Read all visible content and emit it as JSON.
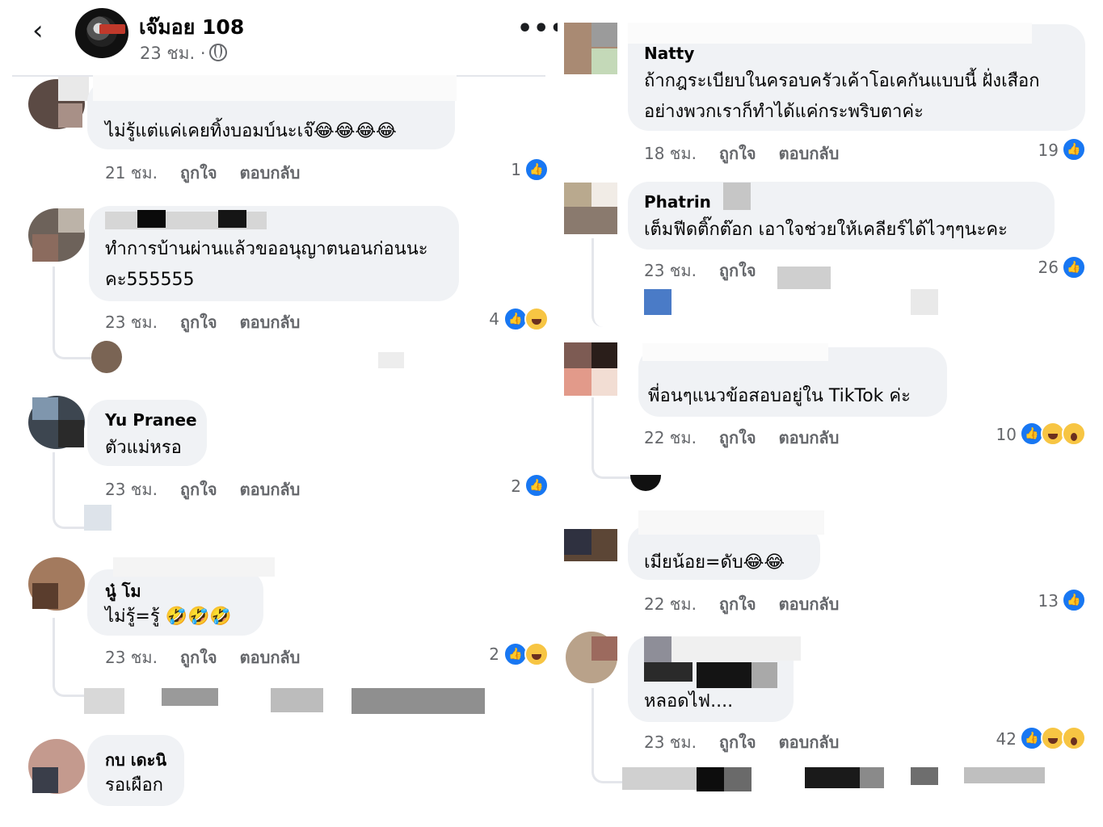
{
  "header": {
    "back_icon": "chevron-left-icon",
    "page_name": "เจ๊มอย 108",
    "page_meta": "23 ชม. ·",
    "more_icon": "more-horizontal-icon"
  },
  "labels": {
    "like": "ถูกใจ",
    "reply": "ตอบกลับ"
  },
  "left_comments": [
    {
      "author": "",
      "text": [
        "ไม่รู้แต่แค่เคยทิ้งบอมบ์นะเจ๊😂😂😂😂"
      ],
      "time": "21 ชม.",
      "count": "1",
      "reactions": [
        "like"
      ]
    },
    {
      "author": "",
      "text": [
        "ทำการบ้านผ่านแล้วขออนุญาตนอนก่อนนะ",
        "คะ555555"
      ],
      "time": "23 ชม.",
      "count": "4",
      "reactions": [
        "like",
        "haha"
      ]
    },
    {
      "author": "Yu Pranee",
      "text": [
        "ตัวแม่หรอ"
      ],
      "time": "23 ชม.",
      "count": "2",
      "reactions": [
        "like"
      ]
    },
    {
      "author": "นู๋ โม",
      "text": [
        "ไม่รู้=รู้ 🤣🤣🤣"
      ],
      "time": "23 ชม.",
      "count": "2",
      "reactions": [
        "like",
        "haha"
      ]
    },
    {
      "author": "กบ เดะนิ",
      "text": [
        "รอเผือก"
      ],
      "time": "",
      "count": "",
      "reactions": []
    }
  ],
  "right_comments": [
    {
      "author": "Natty",
      "text": [
        "ถ้ากฎระเบียบในครอบครัวเค้าโอเคกันแบบนี้ ฝั่งเสือก",
        "อย่างพวกเราก็ทำได้แค่กระพริบตาค่ะ"
      ],
      "time": "18 ชม.",
      "count": "19",
      "reactions": [
        "like"
      ]
    },
    {
      "author": "Phatrin",
      "text": [
        "เต็มฟีดติ๊กต๊อก  เอาใจช่วยให้เคลียร์ได้ไวๆๆนะคะ"
      ],
      "time": "23 ชม.",
      "count": "26",
      "reactions": [
        "like"
      ]
    },
    {
      "author": "",
      "text": [
        "พี่อนๆแนวข้อสอบอยู่ใน TikTok ค่ะ"
      ],
      "time": "22 ชม.",
      "count": "10",
      "reactions": [
        "like",
        "haha",
        "wow"
      ]
    },
    {
      "author": "",
      "text": [
        "เมียน้อย=ดับ😂😂"
      ],
      "time": "22 ชม.",
      "count": "13",
      "reactions": [
        "like"
      ]
    },
    {
      "author": "",
      "text": [
        "หลอดไฟ...."
      ],
      "time": "23 ชม.",
      "count": "42",
      "reactions": [
        "like",
        "haha",
        "wow"
      ]
    }
  ],
  "colors": {
    "bubble": "#f0f2f5",
    "meta_text": "#65676b",
    "like_blue": "#1877f2",
    "text": "#050505"
  }
}
